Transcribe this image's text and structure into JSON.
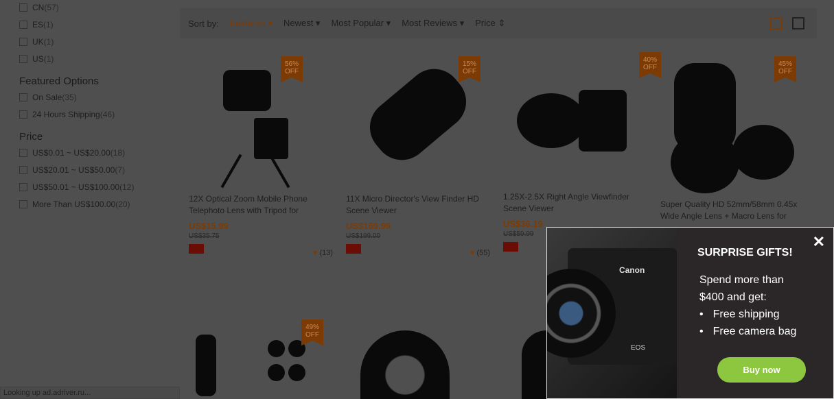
{
  "sidebar": {
    "ship_from": [
      {
        "label": "CN",
        "count": "(57)"
      },
      {
        "label": "ES",
        "count": "(1)"
      },
      {
        "label": "UK",
        "count": "(1)"
      },
      {
        "label": "US",
        "count": "(1)"
      }
    ],
    "featured_title": "Featured Options",
    "featured": [
      {
        "label": "On Sale",
        "count": "(35)"
      },
      {
        "label": "24 Hours Shipping",
        "count": "(46)"
      }
    ],
    "price_title": "Price",
    "price": [
      {
        "label": "US$0.01 ~ US$20.00",
        "count": "(18)"
      },
      {
        "label": "US$20.01 ~ US$50.00",
        "count": "(7)"
      },
      {
        "label": "US$50.01 ~ US$100.00",
        "count": "(12)"
      },
      {
        "label": "More Than US$100.00",
        "count": "(20)"
      }
    ]
  },
  "sort": {
    "label": "Sort by:",
    "options": [
      "Featured ▾",
      "Newest ▾",
      "Most Popular ▾",
      "Most Reviews ▾",
      "Price ⇕"
    ]
  },
  "products": [
    {
      "badge": "56%",
      "off": "OFF",
      "title": "12X Optical Zoom Mobile Phone Telephoto Lens with Tripod for",
      "price": "US$15.99",
      "old": "US$35.75",
      "likes": "(13)"
    },
    {
      "badge": "15%",
      "off": "OFF",
      "title": "11X Micro Director's View Finder HD Scene Viewer",
      "price": "US$169.99",
      "old": "US$199.00",
      "likes": "(55)"
    },
    {
      "badge": "40%",
      "off": "OFF",
      "title": "1.25X-2.5X Right Angle Viewfinder Scene Viewer",
      "price": "US$36.19",
      "old": "US$59.99",
      "likes": ""
    },
    {
      "badge": "45%",
      "off": "OFF",
      "title": "Super Quality HD 52mm/58mm 0.45x Wide Angle Lens + Macro Lens for",
      "price": "",
      "old": "",
      "likes": ""
    },
    {
      "badge": "49%",
      "off": "OFF"
    }
  ],
  "status": "Looking up ad.adriver.ru...",
  "popup": {
    "title": "SURPRISE GIFTS!",
    "line1": "Spend more than",
    "line2": "$400 and get:",
    "items": [
      "Free shipping",
      "Free camera bag"
    ],
    "button": "Buy now",
    "close": "✕",
    "brand": "Canon",
    "model": "EOS",
    "button_color": "#8dc63f"
  }
}
